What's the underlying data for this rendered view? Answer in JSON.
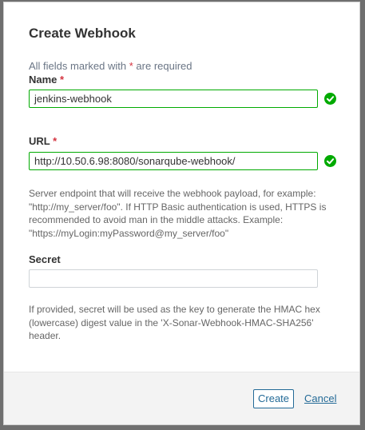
{
  "dialog": {
    "title": "Create Webhook",
    "required_note_prefix": "All fields marked with",
    "required_star": "*",
    "required_note_suffix": "are required"
  },
  "name_field": {
    "label": "Name",
    "required_star": "*",
    "value": "jenkins-webhook",
    "status": "valid"
  },
  "url_field": {
    "label": "URL",
    "required_star": "*",
    "value": "http://10.50.6.98:8080/sonarqube-webhook/",
    "status": "valid",
    "help": "Server endpoint that will receive the webhook payload, for example: \"http://my_server/foo\". If HTTP Basic authentication is used, HTTPS is recommended to avoid man in the middle attacks. Example: \"https://myLogin:myPassword@my_server/foo\""
  },
  "secret_field": {
    "label": "Secret",
    "value": "",
    "help": "If provided, secret will be used as the key to generate the HMAC hex (lowercase) digest value in the 'X-Sonar-Webhook-HMAC-SHA256' header."
  },
  "footer": {
    "create_label": "Create",
    "cancel_label": "Cancel"
  },
  "colors": {
    "valid": "#00aa00",
    "required": "#d4333f",
    "primary": "#236a97"
  },
  "icons": {
    "valid": "check-circle-icon"
  }
}
